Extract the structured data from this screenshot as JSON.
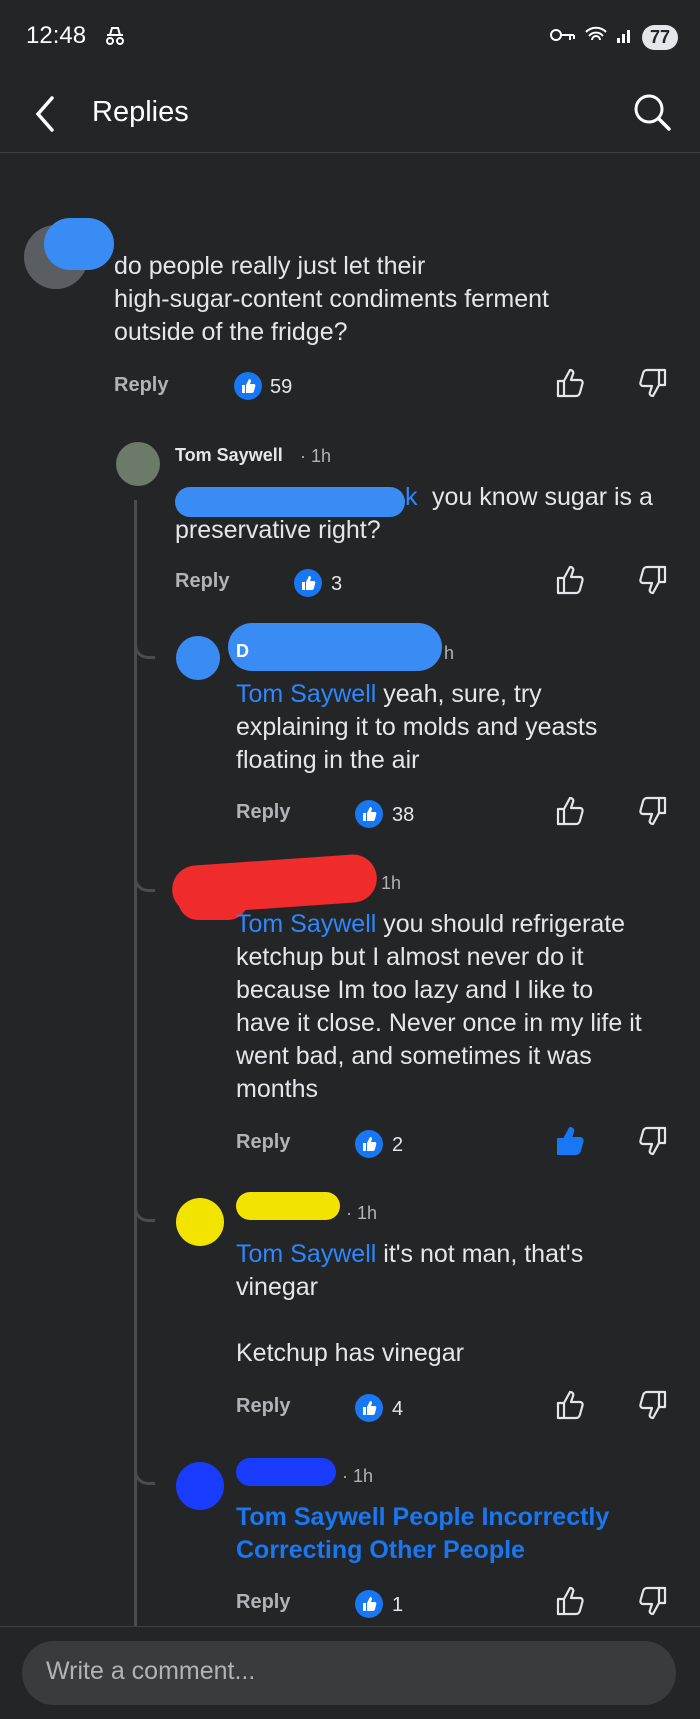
{
  "status_bar": {
    "time": "12:48",
    "battery": "77"
  },
  "header": {
    "title": "Replies"
  },
  "root_comment": {
    "text": "do people really just let their\nhigh-sugar-content condiments ferment\noutside of the fridge?",
    "reply_label": "Reply",
    "likes": "59"
  },
  "replies": [
    {
      "author": "Tom Saywell",
      "time": "· 1h",
      "mention_visible": "k",
      "text": " you know sugar is a\npreservative right?",
      "reply_label": "Reply",
      "likes": "3"
    },
    {
      "author_partial": "D",
      "time": "h",
      "mention": "Tom Saywell",
      "text": " yeah, sure, try\nexplaining it to molds and yeasts\nfloating in the air",
      "reply_label": "Reply",
      "likes": "38"
    },
    {
      "time": "1h",
      "mention": "Tom Saywell",
      "text": " you should refrigerate\nketchup but I almost never do it\nbecause Im too lazy and I like to\nhave it close. Never once in my life it\nwent bad, and sometimes it was\nmonths",
      "reply_label": "Reply",
      "likes": "2",
      "liked": true
    },
    {
      "time": "· 1h",
      "mention": "Tom Saywell",
      "text": " it's not man, that's\nvinegar\n\nKetchup has vinegar",
      "reply_label": "Reply",
      "likes": "4"
    },
    {
      "time": "· 1h",
      "mention_line1": "Tom Saywell People Incorrectly",
      "mention_line2": "Correcting Other People",
      "reply_label": "Reply",
      "likes": "1"
    }
  ],
  "composer": {
    "placeholder": "Write a comment..."
  },
  "colors": {
    "accent": "#1877f2",
    "mention": "#2d88ff",
    "background": "#242527"
  }
}
